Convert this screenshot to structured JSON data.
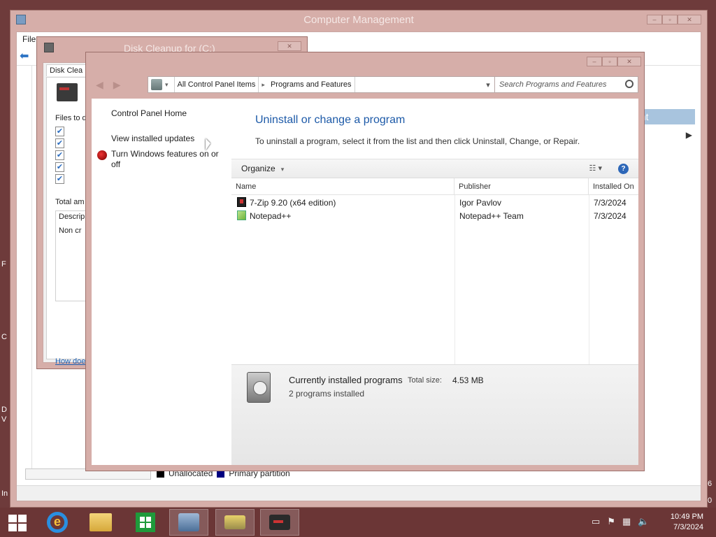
{
  "desktop": {
    "fragments": [
      "F",
      "C",
      "D",
      "V",
      "In"
    ],
    "right_fragments": [
      "6",
      "0"
    ]
  },
  "computer_management": {
    "title": "Computer Management",
    "menu": "File",
    "actions_header": "ent",
    "legend": [
      {
        "label": "Unallocated",
        "color": "#000000"
      },
      {
        "label": "Primary partition",
        "color": "#000080"
      }
    ]
  },
  "disk_cleanup": {
    "title": "Disk Cleanup for  (C:)",
    "tab": "Disk Clea",
    "files_label": "Files to d",
    "total_label": "Total am",
    "description_label": "Descrip",
    "description_text": "Non cr",
    "how_link": "How doe"
  },
  "programs_features": {
    "address": {
      "segments": [
        "All Control Panel Items",
        "Programs and Features"
      ]
    },
    "search_placeholder": "Search Programs and Features",
    "sidebar": {
      "home": "Control Panel Home",
      "updates": "View installed updates",
      "features": "Turn Windows features on or off"
    },
    "heading": "Uninstall or change a program",
    "subtext": "To uninstall a program, select it from the list and then click Uninstall, Change, or Repair.",
    "toolbar": {
      "organize": "Organize"
    },
    "columns": [
      "Name",
      "Publisher",
      "Installed On"
    ],
    "programs": [
      {
        "name": "7-Zip 9.20 (x64 edition)",
        "publisher": "Igor Pavlov",
        "installed_on": "7/3/2024",
        "icon": "7zip-icon"
      },
      {
        "name": "Notepad++",
        "publisher": "Notepad++ Team",
        "installed_on": "7/3/2024",
        "icon": "notepadpp-icon"
      }
    ],
    "details": {
      "title": "Currently installed programs",
      "total_size_label": "Total size:",
      "total_size_value": "4.53 MB",
      "count": "2 programs installed"
    }
  },
  "taskbar": {
    "clock_time": "10:49 PM",
    "clock_date": "7/3/2024"
  }
}
